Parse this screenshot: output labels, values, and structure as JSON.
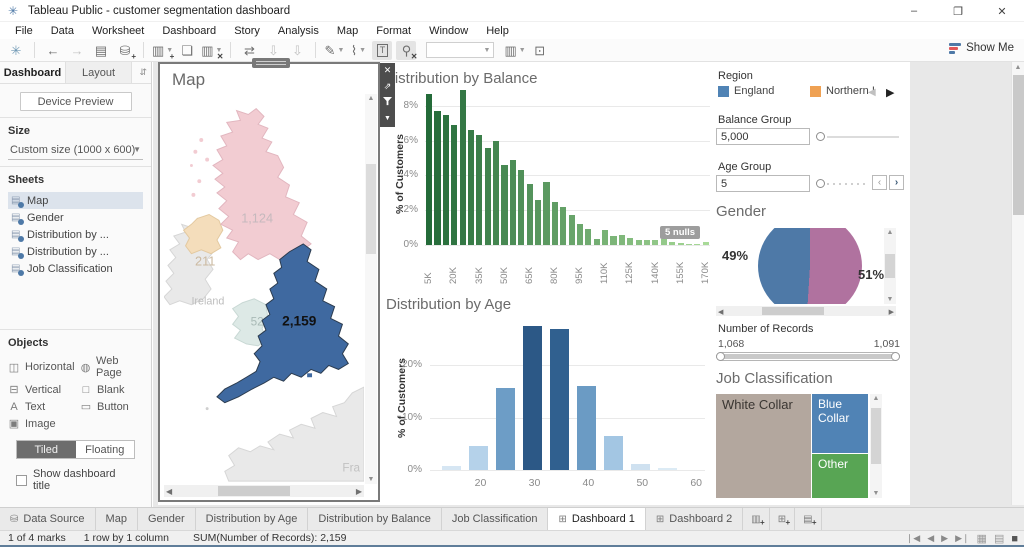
{
  "window": {
    "title": "Tableau Public - customer segmentation dashboard",
    "minimize": "–",
    "maximize": "❐",
    "close": "✕"
  },
  "menu": [
    "File",
    "Data",
    "Worksheet",
    "Dashboard",
    "Story",
    "Analysis",
    "Map",
    "Format",
    "Window",
    "Help"
  ],
  "toolbar": {
    "groups": [
      [
        {
          "name": "tableau-logo-icon",
          "glyph": "✳",
          "color": "#7099b5"
        }
      ],
      [
        {
          "name": "undo-icon",
          "glyph": "←"
        },
        {
          "name": "redo-icon",
          "glyph": "→",
          "dim": true
        },
        {
          "name": "save-icon",
          "glyph": "▤"
        },
        {
          "name": "add-data-icon",
          "glyph": "⛁",
          "plus": "+"
        }
      ],
      [
        {
          "name": "new-worksheet-icon",
          "glyph": "▥",
          "plus": "+",
          "caret": true
        },
        {
          "name": "duplicate-sheet-icon",
          "glyph": "❏"
        },
        {
          "name": "clear-sheet-icon",
          "glyph": "▥",
          "plus": "✕",
          "caret": true
        }
      ],
      [
        {
          "name": "swap-axes-icon",
          "glyph": "⇄"
        },
        {
          "name": "sort-ascending-icon",
          "glyph": "⇩",
          "dim": true
        },
        {
          "name": "sort-descending-icon",
          "glyph": "⇩",
          "dim": true
        }
      ],
      [
        {
          "name": "highlight-icon",
          "glyph": "✎",
          "caret": true
        },
        {
          "name": "hyperlink-icon",
          "glyph": "⌇",
          "caret": true
        },
        {
          "name": "label-icon",
          "glyph": "T",
          "boxed": true,
          "pressed": true
        },
        {
          "name": "pin-icon",
          "glyph": "⚲",
          "plus": "✕",
          "pressed": true
        }
      ]
    ],
    "right_icons": [
      {
        "name": "fit-selector-icon",
        "glyph": "▥",
        "caret": true
      },
      {
        "name": "presentation-mode-icon",
        "glyph": "⊡"
      }
    ],
    "show_me": "Show Me",
    "show_me_colors": [
      "#4e79a7",
      "#e15759",
      "#4e79a7"
    ]
  },
  "sidebar": {
    "tabs": [
      {
        "label": "Dashboard",
        "active": true
      },
      {
        "label": "Layout",
        "active": false
      }
    ],
    "collapse_icon": "⇵",
    "device_preview": "Device Preview",
    "size": {
      "label": "Size",
      "value": "Custom size (1000 x 600)"
    },
    "sheets": {
      "label": "Sheets",
      "selected": 0,
      "items": [
        "Map",
        "Gender",
        "Distribution by ...",
        "Distribution by ...",
        "Job Classification"
      ]
    },
    "objects": {
      "label": "Objects",
      "items": [
        {
          "name": "horizontal",
          "glyph": "◫",
          "label": "Horizontal"
        },
        {
          "name": "web-page",
          "glyph": "◍",
          "label": "Web Page"
        },
        {
          "name": "vertical",
          "glyph": "⊟",
          "label": "Vertical"
        },
        {
          "name": "blank",
          "glyph": "□",
          "label": "Blank"
        },
        {
          "name": "text",
          "glyph": "A",
          "label": "Text"
        },
        {
          "name": "button",
          "glyph": "▭",
          "label": "Button"
        },
        {
          "name": "image",
          "glyph": "▣",
          "label": "Image"
        }
      ]
    },
    "tiled": "Tiled",
    "floating": "Floating",
    "show_title": "Show dashboard title"
  },
  "map": {
    "title": "Map",
    "labels": {
      "scotland": "1,124",
      "northern_ireland": "211",
      "wales": "52",
      "england": "2,159",
      "ireland": "Ireland",
      "france": "Fra"
    },
    "colors": {
      "scotland": "#f2ccd2",
      "northern_ireland": "#f4ddbb",
      "wales": "#dde9e6",
      "england": "#3f69a0",
      "other_land": "#e9e9e9",
      "sea": "#ffffff"
    }
  },
  "chart_data": [
    {
      "id": "balance",
      "type": "bar",
      "title": "Distribution by Balance",
      "ylabel": "% of Customers",
      "y_ticks": [
        0,
        2,
        4,
        6,
        8
      ],
      "ylim": [
        0,
        9
      ],
      "x_tick_labels": [
        "5K",
        "20K",
        "35K",
        "50K",
        "65K",
        "80K",
        "95K",
        "110K",
        "125K",
        "140K",
        "155K",
        "170K"
      ],
      "x_tick_every": 3,
      "values": [
        8.7,
        7.7,
        7.5,
        6.9,
        8.9,
        6.6,
        6.3,
        5.6,
        6.0,
        4.6,
        4.9,
        4.3,
        3.5,
        2.6,
        3.6,
        2.5,
        2.2,
        1.7,
        1.2,
        0.9,
        0.35,
        0.85,
        0.5,
        0.6,
        0.4,
        0.3,
        0.3,
        0.3,
        0.35,
        0.2,
        0.1,
        0.05,
        0.05,
        0.15
      ],
      "color_start": "#246b39",
      "color_end": "#a8da98",
      "annotation": "5 nulls"
    },
    {
      "id": "age",
      "type": "bar",
      "title": "Distribution by Age",
      "ylabel": "% of Customers",
      "y_ticks": [
        0,
        10,
        20
      ],
      "ylim": [
        0,
        29
      ],
      "xlim": [
        11,
        62
      ],
      "x_ticks": [
        20,
        30,
        40,
        50,
        60
      ],
      "bar_centers": [
        15,
        20,
        25,
        30,
        35,
        40,
        45,
        50,
        55
      ],
      "values": [
        0.7,
        4.5,
        15.7,
        27.5,
        26.8,
        16.0,
        6.5,
        1.2,
        0.3
      ],
      "colors": [
        "#d6e6f3",
        "#b5d2ea",
        "#6d9dc6",
        "#2c5886",
        "#30608f",
        "#6b9bc4",
        "#a3c6e3",
        "#cfe1f0",
        "#dcebf5"
      ]
    },
    {
      "id": "gender",
      "type": "pie",
      "title": "Gender",
      "slices": [
        {
          "label": "49%",
          "value": 49,
          "color": "#4e79a7"
        },
        {
          "label": "51%",
          "value": 51,
          "color": "#b0729f"
        }
      ]
    },
    {
      "id": "job",
      "type": "treemap",
      "title": "Job Classification",
      "nodes": [
        {
          "label": "White Collar",
          "color": "#b3a79e",
          "text_color": "#3a3632"
        },
        {
          "label": "Blue Collar",
          "color": "#5083b5",
          "text_color": "#ffffff"
        },
        {
          "label": "Other",
          "color": "#58a554",
          "text_color": "#ffffff"
        }
      ]
    }
  ],
  "right_panel": {
    "region": {
      "label": "Region",
      "entries": [
        {
          "label": "England",
          "color": "#5083b5"
        },
        {
          "label": "Northern I",
          "color": "#efa153"
        }
      ],
      "prev": "◀",
      "next": "▶"
    },
    "balance_group": {
      "label": "Balance Group",
      "value": "5,000"
    },
    "age_group": {
      "label": "Age Group",
      "value": "5",
      "back": "‹",
      "fwd": "›"
    },
    "number_of_records": {
      "label": "Number of Records",
      "min": "1,068",
      "max": "1,091"
    }
  },
  "bottom": {
    "tabs": [
      {
        "label": "Data Source",
        "icon": "⛁"
      },
      {
        "label": "Map"
      },
      {
        "label": "Gender"
      },
      {
        "label": "Distribution by Age"
      },
      {
        "label": "Distribution by Balance"
      },
      {
        "label": "Job Classification"
      },
      {
        "label": "Dashboard 1",
        "icon": "⊞",
        "active": true
      },
      {
        "label": "Dashboard 2",
        "icon": "⊞"
      }
    ],
    "new_buttons": [
      {
        "name": "new-worksheet-button",
        "glyph": "▥"
      },
      {
        "name": "new-dashboard-button",
        "glyph": "⊞"
      },
      {
        "name": "new-story-button",
        "glyph": "▤"
      }
    ]
  },
  "status": {
    "marks": "1 of 4 marks",
    "rows": "1 row by 1 column",
    "sum": "SUM(Number of Records): 2,159",
    "nav": [
      "❘◀",
      "◀",
      "▶",
      "▶❘"
    ],
    "views": [
      "▦",
      "▤",
      "■"
    ]
  }
}
